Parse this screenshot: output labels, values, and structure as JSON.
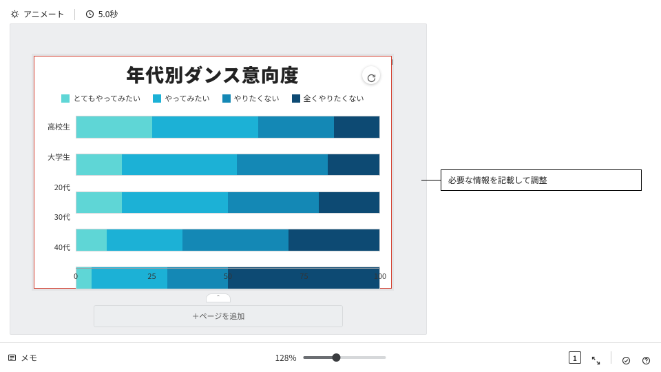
{
  "toolbar": {
    "animate_label": "アニメート",
    "timer_label": "5.0秒"
  },
  "chart_data": {
    "type": "bar",
    "orientation": "horizontal-stacked",
    "title": "年代別ダンス意向度",
    "xlabel": "",
    "ylabel": "",
    "xlim": [
      0,
      100
    ],
    "xticks": [
      0,
      25,
      50,
      75,
      100
    ],
    "categories": [
      "高校生",
      "大学生",
      "20代",
      "30代",
      "40代"
    ],
    "series": [
      {
        "name": "とてもやってみたい",
        "color": "#5fd6d6",
        "values": [
          25,
          15,
          15,
          10,
          5
        ]
      },
      {
        "name": "やってみたい",
        "color": "#1cb1d6",
        "values": [
          35,
          38,
          35,
          25,
          25
        ]
      },
      {
        "name": "やりたくない",
        "color": "#1488b5",
        "values": [
          25,
          30,
          30,
          35,
          20
        ]
      },
      {
        "name": "全くやりたくない",
        "color": "#0d4a73",
        "values": [
          15,
          17,
          20,
          30,
          50
        ]
      }
    ]
  },
  "canvas": {
    "add_page_label": "＋ページを追加"
  },
  "zoom": {
    "value_label": "128%",
    "value_pct": 40
  },
  "notes": {
    "label": "メモ"
  },
  "right": {
    "page_label": "1"
  },
  "callout": {
    "text": "必要な情報を記載して調整"
  }
}
